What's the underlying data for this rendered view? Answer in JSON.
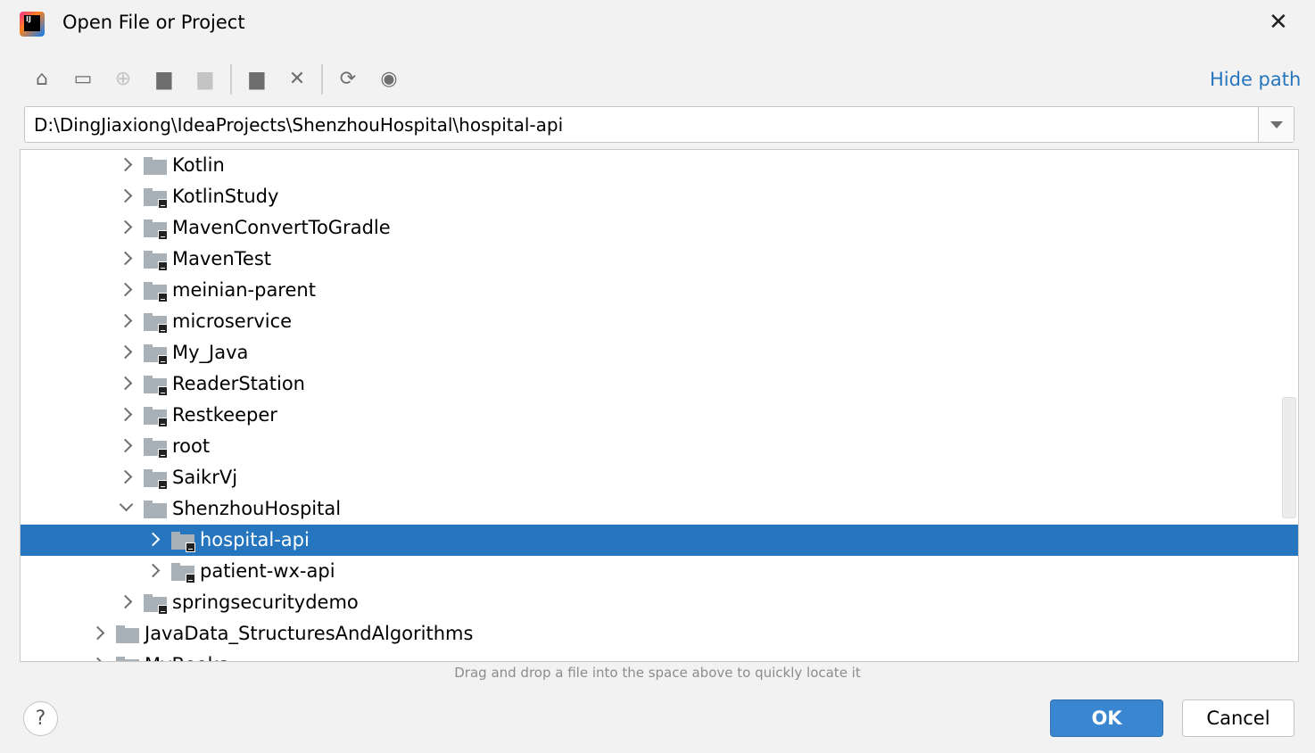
{
  "window": {
    "title": "Open File or Project",
    "close_icon": "close-icon"
  },
  "toolbar": {
    "items": [
      {
        "name": "home-icon",
        "glyph": "⌂",
        "enabled": true
      },
      {
        "name": "desktop-icon",
        "glyph": "▭",
        "enabled": true
      },
      {
        "name": "locate-icon",
        "glyph": "⊕",
        "enabled": false
      },
      {
        "name": "project-folder-icon",
        "glyph": "▆",
        "enabled": true
      },
      {
        "name": "module-folder-icon",
        "glyph": "▆",
        "enabled": false
      },
      {
        "name": "new-folder-icon",
        "glyph": "▆",
        "enabled": true
      },
      {
        "name": "delete-icon",
        "glyph": "✕",
        "enabled": true
      },
      {
        "name": "refresh-icon",
        "glyph": "⟳",
        "enabled": true
      },
      {
        "name": "show-hidden-icon",
        "glyph": "◉",
        "enabled": true
      }
    ],
    "hide_path": "Hide path"
  },
  "path": {
    "value": "D:\\DingJiaxiong\\IdeaProjects\\ShenzhouHospital\\hospital-api"
  },
  "tree": {
    "rows": [
      {
        "label": "Kotlin",
        "level": 2,
        "expanded": false,
        "module": false
      },
      {
        "label": "KotlinStudy",
        "level": 2,
        "expanded": false,
        "module": true
      },
      {
        "label": "MavenConvertToGradle",
        "level": 2,
        "expanded": false,
        "module": true
      },
      {
        "label": "MavenTest",
        "level": 2,
        "expanded": false,
        "module": true
      },
      {
        "label": "meinian-parent",
        "level": 2,
        "expanded": false,
        "module": true
      },
      {
        "label": "microservice",
        "level": 2,
        "expanded": false,
        "module": true
      },
      {
        "label": "My_Java",
        "level": 2,
        "expanded": false,
        "module": true
      },
      {
        "label": "ReaderStation",
        "level": 2,
        "expanded": false,
        "module": true
      },
      {
        "label": "Restkeeper",
        "level": 2,
        "expanded": false,
        "module": true
      },
      {
        "label": "root",
        "level": 2,
        "expanded": false,
        "module": true
      },
      {
        "label": "SaikrVj",
        "level": 2,
        "expanded": false,
        "module": true
      },
      {
        "label": "ShenzhouHospital",
        "level": 2,
        "expanded": true,
        "module": false
      },
      {
        "label": "hospital-api",
        "level": 3,
        "expanded": false,
        "module": true,
        "selected": true
      },
      {
        "label": "patient-wx-api",
        "level": 3,
        "expanded": false,
        "module": true
      },
      {
        "label": "springsecuritydemo",
        "level": 2,
        "expanded": false,
        "module": true
      },
      {
        "label": "JavaData_StructuresAndAlgorithms",
        "level": 1,
        "expanded": false,
        "module": false
      },
      {
        "label": "MyBooks",
        "level": 1,
        "expanded": false,
        "module": false
      }
    ]
  },
  "hint": "Drag and drop a file into the space above to quickly locate it",
  "buttons": {
    "help": "?",
    "ok": "OK",
    "cancel": "Cancel"
  },
  "colors": {
    "accent": "#2675bf",
    "selection": "#2675bf",
    "ok_button": "#3a86d0"
  }
}
